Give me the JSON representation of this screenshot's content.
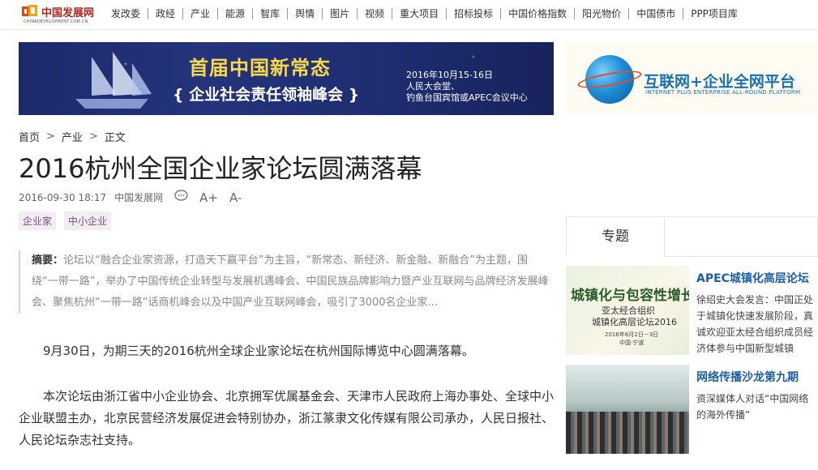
{
  "logo": {
    "name": "中国发展网",
    "sub": "CHINADEVELOPMENT.COM.CN"
  },
  "nav": [
    "发改委",
    "政经",
    "产业",
    "能源",
    "智库",
    "舆情",
    "图片",
    "视频",
    "重大项目",
    "招标投标",
    "中国价格指数",
    "阳光物价",
    "中国债市",
    "PPP项目库"
  ],
  "banner_left": {
    "title": "首届中国新常态",
    "subtitle": "{ 企业社会责任领袖峰会 }",
    "date": "2016年10月15-16日",
    "venue1": "人民大会堂、",
    "venue2": "钓鱼台国宾馆或APEC会议中心"
  },
  "banner_right": {
    "title": "互联网+企业全网平台",
    "subtitle": "INTERNET PLUS ENTERPRISE ALL-ROUND PLATFORM"
  },
  "breadcrumb": {
    "home": "首页",
    "sep": ">",
    "section": "产业",
    "current": "正文"
  },
  "article": {
    "title": "2016杭州全国企业家论坛圆满落幕",
    "datetime": "2016-09-30 18:17",
    "source": "中国发展网",
    "icons": {
      "comment": "comment-icon",
      "font_up": "A+",
      "font_down": "A-"
    },
    "tags": [
      "企业家",
      "中小企业"
    ],
    "summary_label": "摘要：",
    "summary": "论坛以“融合企业家资源，打造天下赢平台”为主旨，“新常态、新经济、新金融、新融合”为主题，围绕“一带一路”，举办了中国传统企业转型与发展机遇峰会、中国民族品牌影响力暨产业互联网与品牌经济发展峰会、聚焦杭州“一带一路”话商机峰会以及中国产业互联网峰会，吸引了3000名企业家...",
    "paragraphs": [
      "9月30日，为期三天的2016杭州全球企业家论坛在杭州国际博览中心圆满落幕。",
      "本次论坛由浙江省中小企业协会、北京拥军优属基金会、天津市人民政府上海办事处、全球中小企业联盟主办，北京民营经济发展促进会特别协办，浙江篆隶文化传媒有限公司承办，人民日报社、人民论坛杂志社支持。"
    ]
  },
  "sidebar": {
    "tab": "专题",
    "cards": [
      {
        "title": "APEC城镇化高层论坛",
        "desc": "徐绍史大会发言：中国正处于城镇化快速发展阶段，真诚欢迎亚太经合组织成员经济体参与中国新型城镇",
        "thumb": {
          "t1": "城镇化与包容性增长",
          "t2": "亚太经合组织",
          "t3": "城镇化高层论坛2016",
          "t4": "2016年6月2日－3日",
          "t5": "中国·宁波"
        }
      },
      {
        "title": "网络传播沙龙第九期",
        "desc": "资深媒体人对话“中国网络的海外传播”"
      }
    ]
  }
}
